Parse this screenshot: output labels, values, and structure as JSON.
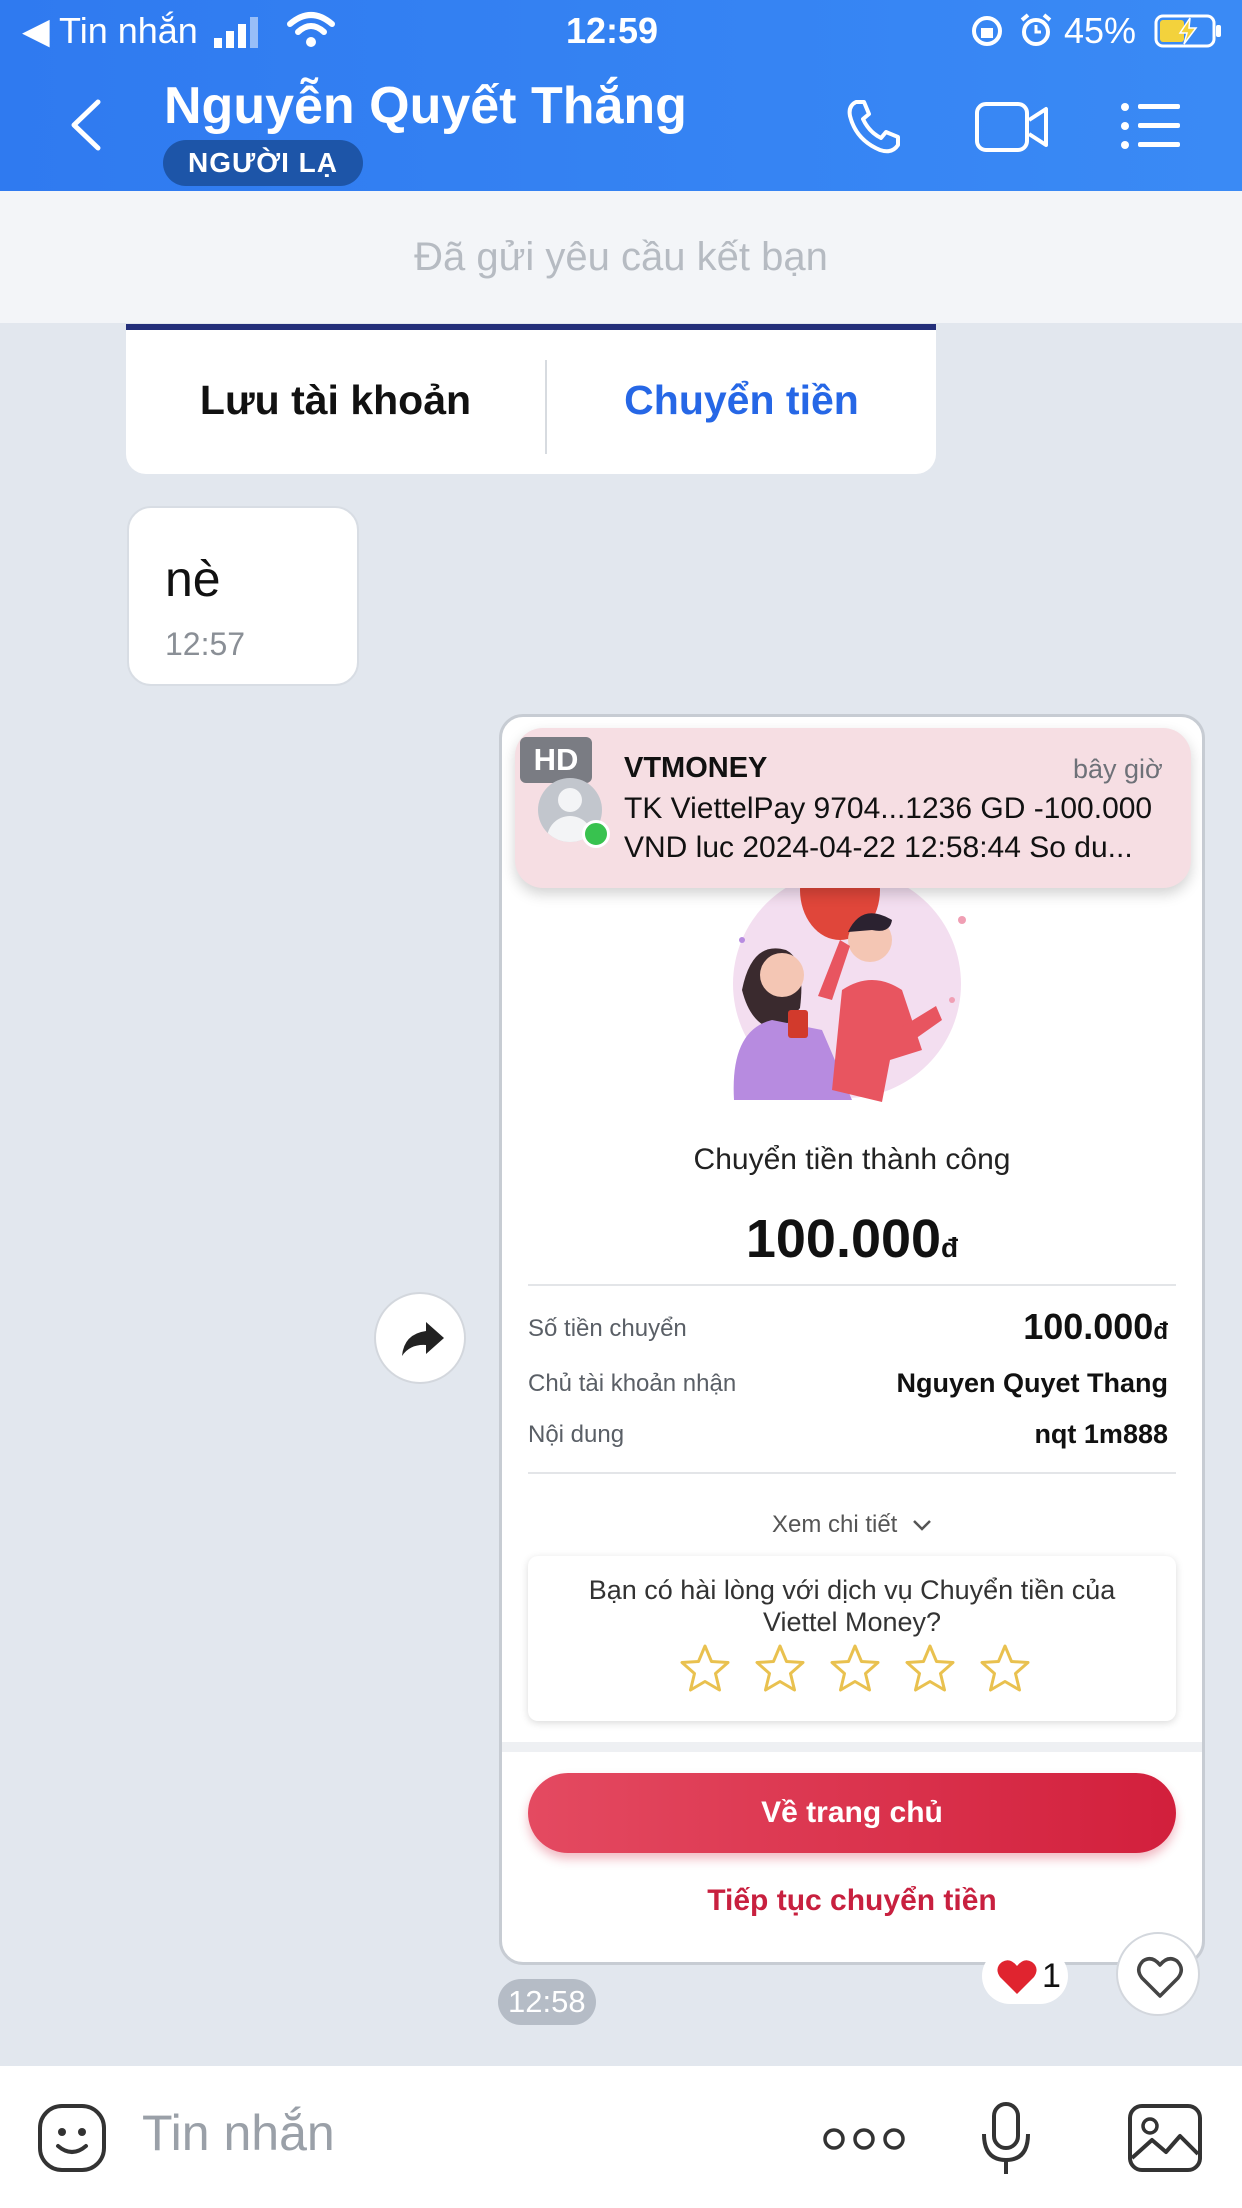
{
  "status_bar": {
    "back_app": "◀ Tin nhắn",
    "time": "12:59",
    "battery": "45%"
  },
  "header": {
    "title": "Nguyễn Quyết Thắng",
    "badge": "NGƯỜI LẠ"
  },
  "friend_request": {
    "text": "Đã gửi yêu cầu kết bạn"
  },
  "bank_card": {
    "save_label": "Lưu tài khoản",
    "transfer_label": "Chuyển tiền"
  },
  "message": {
    "text": "nè",
    "time": "12:57"
  },
  "notification": {
    "badge": "HD",
    "app": "VTMONEY",
    "time": "bây giờ",
    "line1": "TK ViettelPay 9704...1236 GD -100.000",
    "line2": "VND luc 2024-04-22 12:58:44 So du..."
  },
  "receipt": {
    "status": "Chuyển tiền thành công",
    "amount": "100.000",
    "currency": "đ",
    "rows": [
      {
        "label": "Số tiền chuyển",
        "value": "100.000",
        "unit": "đ"
      },
      {
        "label": "Chủ tài khoản nhận",
        "value": "Nguyen Quyet Thang"
      },
      {
        "label": "Nội dung",
        "value": "nqt 1m888"
      }
    ],
    "details_link": "Xem chi tiết",
    "survey_question": "Bạn có hài lòng với dịch vụ Chuyển tiền của Viettel Money?",
    "primary_button": "Về trang chủ",
    "secondary_button": "Tiếp tục chuyển tiền",
    "star_color": "#e9c14f"
  },
  "image_message": {
    "time": "12:58",
    "reaction_count": "1"
  },
  "composer": {
    "placeholder": "Tin nhắn"
  },
  "colors": {
    "header_blue": "#3381f2",
    "link_blue": "#2667e6",
    "brand_red": "#d21f3c"
  }
}
